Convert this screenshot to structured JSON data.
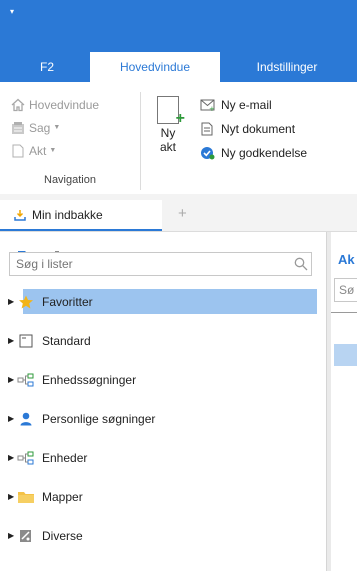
{
  "window": {
    "qat_glyph": "▾"
  },
  "ribbon_tabs": [
    {
      "label": "F2"
    },
    {
      "label": "Hovedvindue"
    },
    {
      "label": "Indstillinger"
    }
  ],
  "navigation_group": {
    "label": "Navigation",
    "items": [
      {
        "label": "Hovedvindue",
        "icon": "home-icon"
      },
      {
        "label": "Sag",
        "icon": "case-icon",
        "dropdown": true
      },
      {
        "label": "Akt",
        "icon": "document-icon",
        "dropdown": true
      }
    ]
  },
  "new_group": {
    "ny_akt_line1": "Ny",
    "ny_akt_line2": "akt",
    "actions": [
      {
        "label": "Ny e-mail",
        "icon": "new-email-icon"
      },
      {
        "label": "Nyt dokument",
        "icon": "new-document-icon"
      },
      {
        "label": "Ny godkendelse",
        "icon": "approval-icon"
      }
    ]
  },
  "inbox_tab": {
    "label": "Min indbakke",
    "add_glyph": "+"
  },
  "left_pane": {
    "search_placeholder": "Søg i lister",
    "tree": [
      {
        "label": "Favoritter",
        "icon": "star-icon"
      },
      {
        "label": "Standard",
        "icon": "standard-icon"
      },
      {
        "label": "Enhedssøgninger",
        "icon": "units-icon"
      },
      {
        "label": "Personlige søgninger",
        "icon": "person-icon"
      },
      {
        "label": "Enheder",
        "icon": "units-icon"
      },
      {
        "label": "Mapper",
        "icon": "folder-icon"
      },
      {
        "label": "Diverse",
        "icon": "misc-icon"
      }
    ]
  },
  "right_pane": {
    "header": "Ak",
    "search_text": "Sø"
  },
  "colors": {
    "accent": "#2b79d6",
    "selection": "#9cc4ef",
    "star": "#f2b418",
    "folder": "#f4c247",
    "green": "#2e9a3a"
  }
}
